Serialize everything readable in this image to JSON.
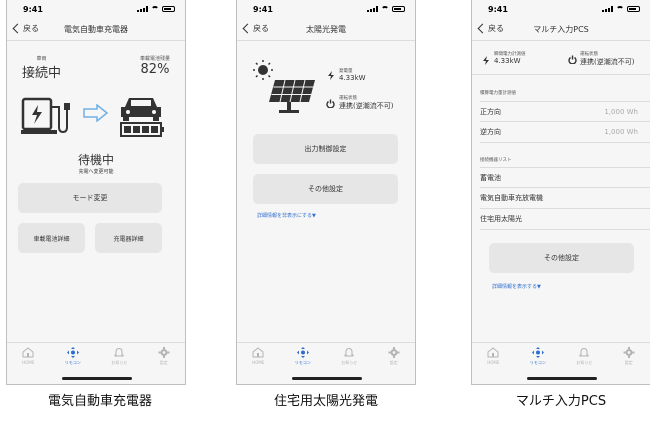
{
  "status": {
    "time": "9:41"
  },
  "tabs": [
    {
      "label": "HOME",
      "icon": "home-icon"
    },
    {
      "label": "リモコン",
      "icon": "remote-icon"
    },
    {
      "label": "お知らせ",
      "icon": "bell-icon"
    },
    {
      "label": "設定",
      "icon": "gear-icon"
    }
  ],
  "accent_color": "#2f6fd0",
  "screen1": {
    "back": "戻る",
    "title": "電気自動車充電器",
    "vehicle_label": "車両",
    "vehicle_status": "接続中",
    "battery_label": "車載電池残量",
    "battery_value": "82%",
    "state_main": "待機中",
    "state_sub": "充電へ変更可能",
    "mode_button": "モード変更",
    "battery_detail_button": "車載電池詳細",
    "charger_detail_button": "充電器詳細",
    "caption": "電気自動車充電器"
  },
  "screen2": {
    "back": "戻る",
    "title": "太陽光発電",
    "gen_label": "発電量",
    "gen_value": "4.33kW",
    "op_label": "運転状態",
    "op_value": "連携(逆潮流不可)",
    "output_button": "出力制御設定",
    "other_button": "その他設定",
    "toggle_link": "詳細情報を非表示にする▼",
    "caption": "住宅用太陽光発電"
  },
  "screen3": {
    "back": "戻る",
    "title": "マルチ入力PCS",
    "power_label": "瞬間電力計測値",
    "power_value": "4.33kW",
    "op_label": "運転状態",
    "op_value": "連携(逆潮流不可)",
    "cumulative_header": "積算電力量計測値",
    "forward_label": "正方向",
    "forward_value": "1,000 Wh",
    "reverse_label": "逆方向",
    "reverse_value": "1,000 Wh",
    "devices_header": "接続機器リスト",
    "devices": [
      "蓄電池",
      "電気自動車充放電機",
      "住宅用太陽光"
    ],
    "other_button": "その他設定",
    "toggle_link": "詳細情報を表示する▼",
    "caption": "マルチ入力PCS"
  }
}
